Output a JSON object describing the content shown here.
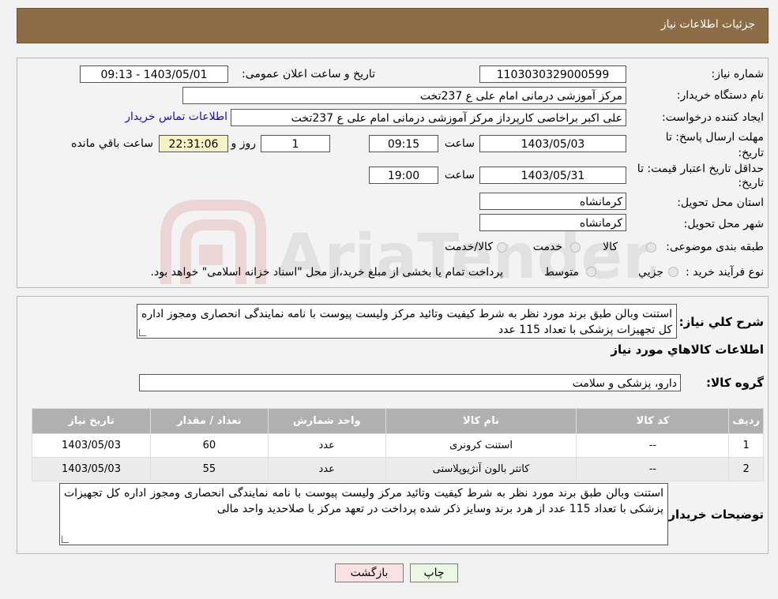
{
  "header": {
    "title": "جزئیات اطلاعات نیاز"
  },
  "form": {
    "need_number_label": "شماره نیاز:",
    "need_number": "1103030329000599",
    "announce_label": "تاریخ و ساعت اعلان عمومی:",
    "announce_value": "1403/05/01 - 09:13",
    "buyer_org_label": "نام دستگاه خریدار:",
    "buyer_org": "مرکز آموزشی درمانی امام علی ع 237تخت",
    "creator_label": "ایجاد کننده درخواست:",
    "creator": "علی اکبر براخاصی کارپرداز  مرکز آموزشی درمانی امام علی ع 237تخت",
    "contact_link": "اطلاعات تماس خریدار",
    "deadline_label": "مهلت ارسال پاسخ: تا تاریخ:",
    "deadline_date": "1403/05/03",
    "time_label": "ساعت",
    "deadline_time": "09:15",
    "days_value": "1",
    "days_label": "روز و",
    "remaining_time": "22:31:06",
    "remaining_label": "ساعت باقي مانده",
    "validity_label": "حداقل تاریخ اعتبار قیمت: تا تاریخ:",
    "validity_date": "1403/05/31",
    "validity_time": "19:00",
    "province_label": "استان محل تحویل:",
    "province": "کرمانشاه",
    "city_label": "شهر محل تحویل:",
    "city": "کرمانشاه",
    "category_label": "طبقه بندی موضوعی:",
    "category_options": [
      "کالا",
      "خدمت",
      "کالا/خدمت"
    ],
    "process_label": "نوع فرآیند خرید :",
    "process_options": [
      "جزیي",
      "متوسط"
    ],
    "process_note": "پرداخت تمام یا بخشی از مبلغ خرید،از محل \"اسناد خزانه اسلامی\" خواهد بود."
  },
  "summary": {
    "label": "شرح كلي نياز:",
    "text": "استنت وبالن طبق برند مورد نظر به شرط کیفیت وتائید مرکز ولیست پیوست با نامه نمایندگی انحصاری ومجوز اداره کل تجهیزات پزشکی با تعداد 115 عدد",
    "items_title": "اطلاعات كالاهاي مورد نياز",
    "group_label": "گروه كالا:",
    "group_value": "دارو، پزشکی و سلامت"
  },
  "table": {
    "headers": [
      "رديف",
      "كد كالا",
      "نام كالا",
      "واحد شمارش",
      "تعداد / مقدار",
      "تاريخ نياز"
    ],
    "rows": [
      [
        "1",
        "--",
        "استنت کرونری",
        "عدد",
        "60",
        "1403/05/03"
      ],
      [
        "2",
        "--",
        "کاتتر بالون آنژیوپلاستی",
        "عدد",
        "55",
        "1403/05/03"
      ]
    ]
  },
  "notes": {
    "label": "توضیحات خریدار:",
    "text": "استنت وبالن طبق برند مورد نظر به شرط کیفیت وتائید مرکز ولیست پیوست با نامه نمایندگی انحصاری ومجوز اداره کل تجهیزات پزشکی با تعداد 115 عدد از هرد برند وسایز ذکر شده پرداخت در تعهد مرکز با صلاحدید واحد مالی"
  },
  "buttons": {
    "print": "چاپ",
    "back": "بازگشت"
  },
  "colors": {
    "header_bg": "#8c6d47",
    "table_header_bg": "#b0b0b0",
    "print_bg": "#e9f7e4",
    "back_bg": "#fbe2e2"
  },
  "watermark": "AriaTender.neT"
}
